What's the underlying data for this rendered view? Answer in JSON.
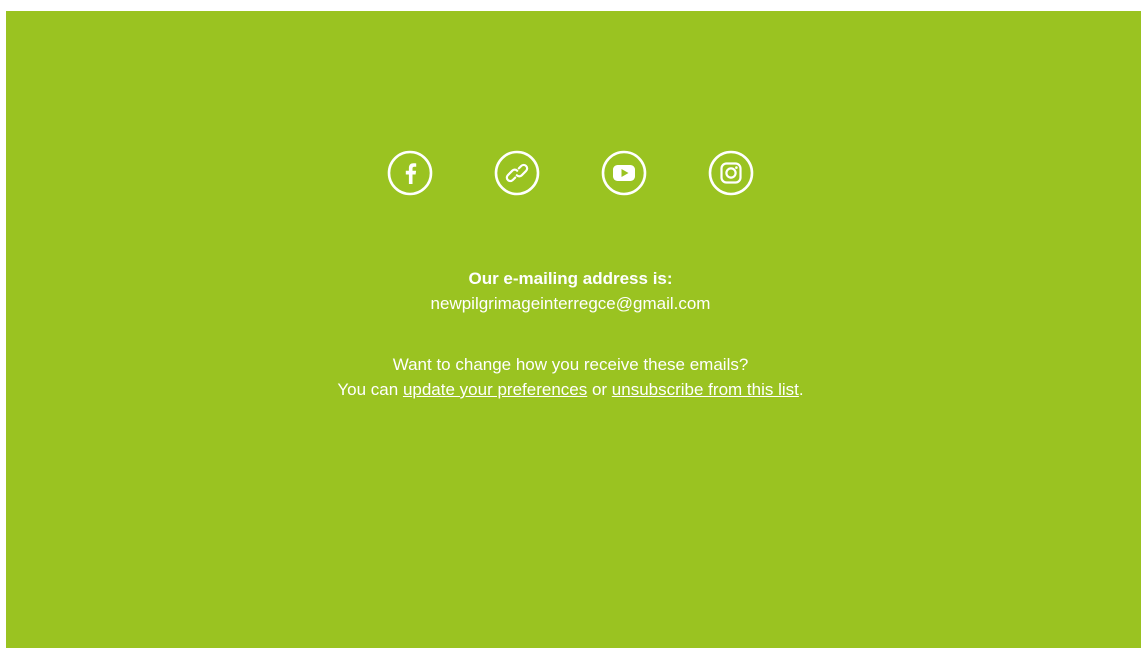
{
  "footer": {
    "social": [
      {
        "name": "facebook-icon"
      },
      {
        "name": "link-icon"
      },
      {
        "name": "youtube-icon"
      },
      {
        "name": "instagram-icon"
      }
    ],
    "heading": "Our e-mailing address is:",
    "email": "newpilgrimageinterregce@gmail.com",
    "change_text": "Want to change how you receive these emails?",
    "prefix": "You can ",
    "update_link": "update your preferences",
    "middle": " or ",
    "unsubscribe_link": "unsubscribe from this list",
    "suffix": "."
  },
  "colors": {
    "background": "#9ac321",
    "text": "#ffffff"
  }
}
